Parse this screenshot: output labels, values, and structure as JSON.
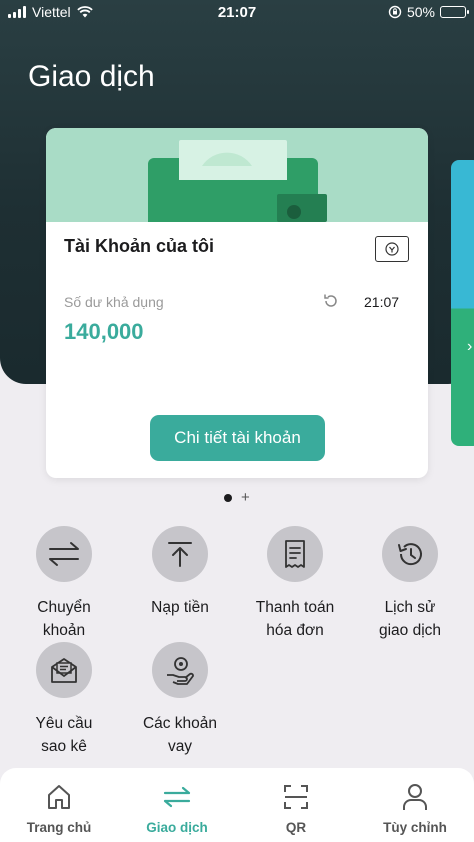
{
  "status_bar": {
    "carrier": "Viettel",
    "time": "21:07",
    "battery": "50%",
    "battery_level": 0.5
  },
  "header": {
    "title": "Giao dịch"
  },
  "account_card": {
    "title": "Tài Khoản của tôi",
    "balance_label": "Số dư khả dụng",
    "balance": "140,000",
    "updated_time": "21:07",
    "detail_button": "Chi tiết tài khoản"
  },
  "pager": {
    "current": 1,
    "add_symbol": "+"
  },
  "actions": [
    {
      "label": "Chuyển\nkhoản",
      "icon": "transfer-icon"
    },
    {
      "label": "Nạp tiền",
      "icon": "deposit-icon"
    },
    {
      "label": "Thanh toán\nhóa đơn",
      "icon": "bill-icon"
    },
    {
      "label": "Lịch sử\ngiao dịch",
      "icon": "history-icon"
    },
    {
      "label": "Yêu cầu\nsao kê",
      "icon": "statement-icon"
    },
    {
      "label": "Các khoản\nvay",
      "icon": "loan-icon"
    }
  ],
  "tabbar": [
    {
      "label": "Trang chủ",
      "icon": "home-icon",
      "active": false
    },
    {
      "label": "Giao dịch",
      "icon": "transfer-icon",
      "active": true
    },
    {
      "label": "QR",
      "icon": "qr-scan-icon",
      "active": false
    },
    {
      "label": "Tùy chỉnh",
      "icon": "user-icon",
      "active": false
    }
  ],
  "colors": {
    "accent": "#3aab9c",
    "hero": "#1e2f33",
    "banner": "#a9dcc6",
    "icon_circle": "#c6c5ca"
  }
}
